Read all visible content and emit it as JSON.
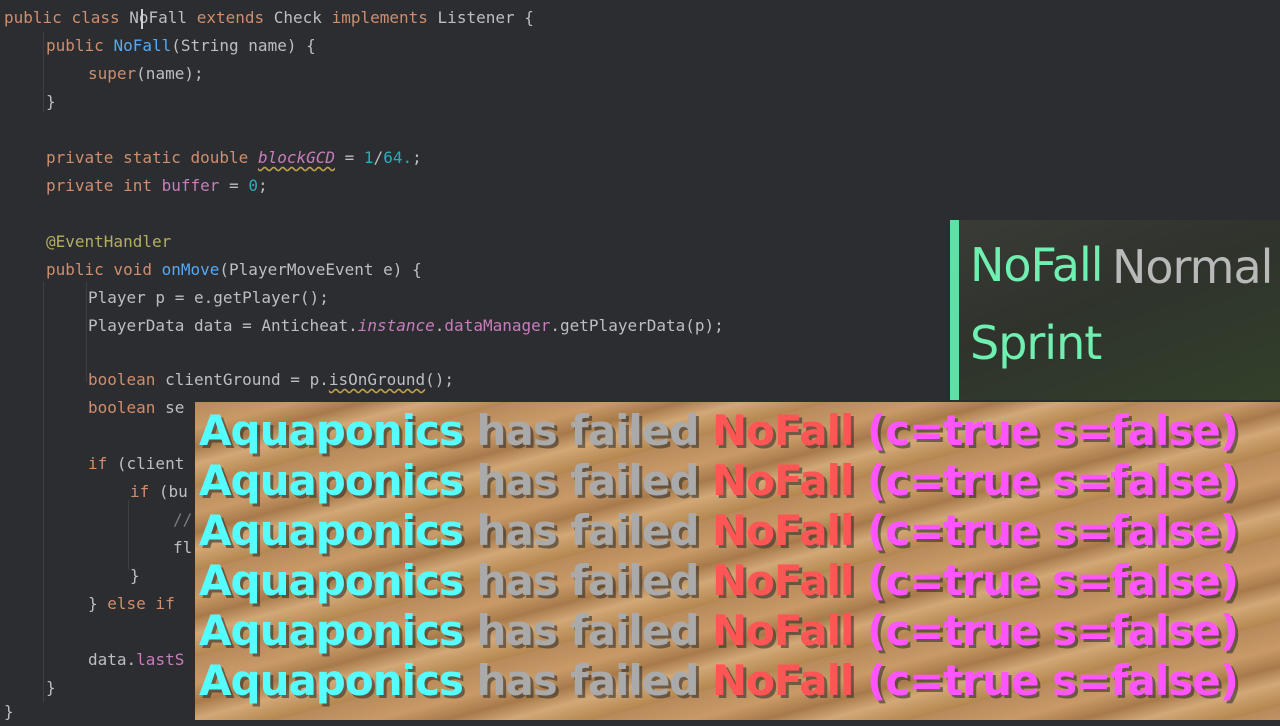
{
  "editor": {
    "lines": {
      "l1": {
        "kw_public": "public",
        "kw_class": "class",
        "name": "NoFall",
        "kw_extends": "extends",
        "parent": "Check",
        "kw_implements": "implements",
        "iface": "Listener {"
      },
      "l2": {
        "kw_public": "public",
        "ctor": "NoFall",
        "rest": "(String name) {"
      },
      "l3": {
        "kw_super": "super",
        "rest": "(name);"
      },
      "l4": {
        "text": "}"
      },
      "l5": {
        "kw": "private static double",
        "field": "blockGCD",
        "eq": " = ",
        "num1": "1",
        "slash": "/",
        "num2": "64.",
        "semi": ";"
      },
      "l6": {
        "kw": "private int",
        "field": "buffer",
        "eq": " = ",
        "num": "0",
        "semi": ";"
      },
      "l7": {
        "text": "@EventHandler"
      },
      "l8": {
        "kw": "public void",
        "method": "onMove",
        "rest": "(PlayerMoveEvent e) {"
      },
      "l9": {
        "text": "Player p = e.getPlayer();"
      },
      "l10": {
        "pre": "PlayerData data = Anticheat.",
        "inst": "instance",
        "dot": ".",
        "dm": "dataManager",
        "post": ".getPlayerData(p);"
      },
      "l11": {
        "kw": "boolean",
        "pre": " clientGround = p.",
        "call": "isOnGround",
        "post": "();"
      },
      "l12": {
        "kw": "boolean",
        "pre": " se"
      },
      "l13": {
        "kw": "if",
        "pre": " (client"
      },
      "l14": {
        "kw": "if",
        "pre": " (bu"
      },
      "l15": {
        "text": "//"
      },
      "l16": {
        "text": "fl"
      },
      "l17": {
        "text": "}"
      },
      "l18": {
        "pre": "} ",
        "kw": "else if"
      },
      "l19": {
        "pre": "data.",
        "field": "lastS"
      },
      "l20": {
        "text": "}"
      },
      "l21": {
        "text": "}"
      }
    }
  },
  "overlay": {
    "check_name": "NoFall",
    "mode": "Normal",
    "second": "Sprint",
    "accent_color": "#5ee0a7"
  },
  "chat": {
    "messages": [
      {
        "player": "Aquaponics",
        "middle": " has failed ",
        "check": "NoFall",
        "detail": " (c=true s=false)"
      },
      {
        "player": "Aquaponics",
        "middle": " has failed ",
        "check": "NoFall",
        "detail": " (c=true s=false)"
      },
      {
        "player": "Aquaponics",
        "middle": " has failed ",
        "check": "NoFall",
        "detail": " (c=true s=false)"
      },
      {
        "player": "Aquaponics",
        "middle": " has failed ",
        "check": "NoFall",
        "detail": " (c=true s=false)"
      },
      {
        "player": "Aquaponics",
        "middle": " has failed ",
        "check": "NoFall",
        "detail": " (c=true s=false)"
      },
      {
        "player": "Aquaponics",
        "middle": " has failed ",
        "check": "NoFall",
        "detail": " (c=true s=false)"
      }
    ],
    "colors": {
      "player": "#55ffff",
      "middle": "#aaaaaa",
      "check": "#ff5555",
      "detail": "#ff55ff"
    }
  }
}
